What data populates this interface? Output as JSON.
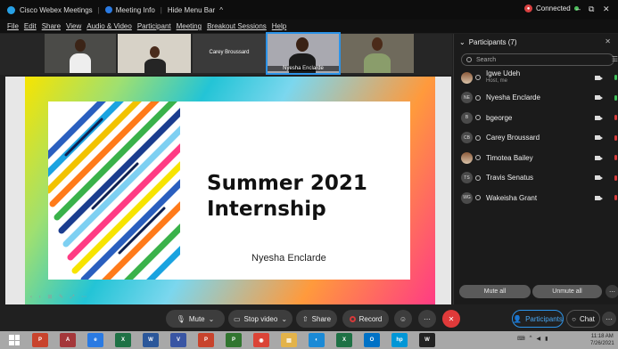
{
  "titlebar": {
    "app_title": "Cisco Webex Meetings",
    "meeting_info": "Meeting Info",
    "hide_menu": "Hide Menu Bar",
    "connection": "Connected",
    "minimize": "–",
    "restore": "⧉",
    "close": "✕"
  },
  "menubar": {
    "items": [
      "File",
      "Edit",
      "Share",
      "View",
      "Audio & Video",
      "Participant",
      "Meeting",
      "Breakout Sessions",
      "Help"
    ]
  },
  "video_strip": {
    "tiles": [
      {
        "label": ""
      },
      {
        "label": ""
      },
      {
        "label": "Carey Broussard"
      },
      {
        "label": "Nyesha Enclarde"
      },
      {
        "label": ""
      }
    ]
  },
  "slide": {
    "title": "Summer 2021\nInternship",
    "presenter": "Nyesha Enclarde",
    "toolbar_glyphs": "‹ › ⊞ ✎ ⤢ ⋯"
  },
  "participants": {
    "header": "Participants (7)",
    "search_placeholder": "Search",
    "people": [
      {
        "initials": "",
        "name": "Igwe Udeh",
        "subtitle": "Host, me",
        "mic": "green",
        "photo": true
      },
      {
        "initials": "NE",
        "name": "Nyesha Enclarde",
        "subtitle": "",
        "mic": "green",
        "photo": false
      },
      {
        "initials": "B",
        "name": "bgeorge",
        "subtitle": "",
        "mic": "red",
        "photo": false
      },
      {
        "initials": "CB",
        "name": "Carey Broussard",
        "subtitle": "",
        "mic": "red",
        "photo": false
      },
      {
        "initials": "",
        "name": "Timotea Bailey",
        "subtitle": "",
        "mic": "red",
        "photo": true
      },
      {
        "initials": "TS",
        "name": "Travis Senatus",
        "subtitle": "",
        "mic": "red",
        "photo": false
      },
      {
        "initials": "WG",
        "name": "Wakeisha Grant",
        "subtitle": "",
        "mic": "red",
        "photo": false
      }
    ],
    "mute_all": "Mute all",
    "unmute_all": "Unmute all"
  },
  "controls": {
    "mute": "Mute",
    "stop_video": "Stop video",
    "share": "Share",
    "record": "Record",
    "participants": "Participants",
    "chat": "Chat"
  },
  "taskbar": {
    "apps": [
      {
        "glyph": "P",
        "color": "#c8432c"
      },
      {
        "glyph": "A",
        "color": "#a4373a"
      },
      {
        "glyph": "e",
        "color": "#2a7ae2"
      },
      {
        "glyph": "X",
        "color": "#1e7145"
      },
      {
        "glyph": "W",
        "color": "#2b579a"
      },
      {
        "glyph": "V",
        "color": "#3955a3"
      },
      {
        "glyph": "P",
        "color": "#c8432c"
      },
      {
        "glyph": "P",
        "color": "#31752f"
      },
      {
        "glyph": "◉",
        "color": "#db4437"
      },
      {
        "glyph": "▤",
        "color": "#e3b34a"
      },
      {
        "glyph": "◐",
        "color": "#1b8ad6"
      },
      {
        "glyph": "X",
        "color": "#1e7145"
      },
      {
        "glyph": "O",
        "color": "#0072c6"
      },
      {
        "glyph": "hp",
        "color": "#0096d6"
      },
      {
        "glyph": "W",
        "color": "#222"
      }
    ],
    "time": "11:18 AM",
    "date": "7/26/2021"
  },
  "colors": {
    "accent": "#2c93e8",
    "end_call": "#e03a3a",
    "muted": "#d63a3a",
    "unmuted": "#3fbf5a"
  }
}
